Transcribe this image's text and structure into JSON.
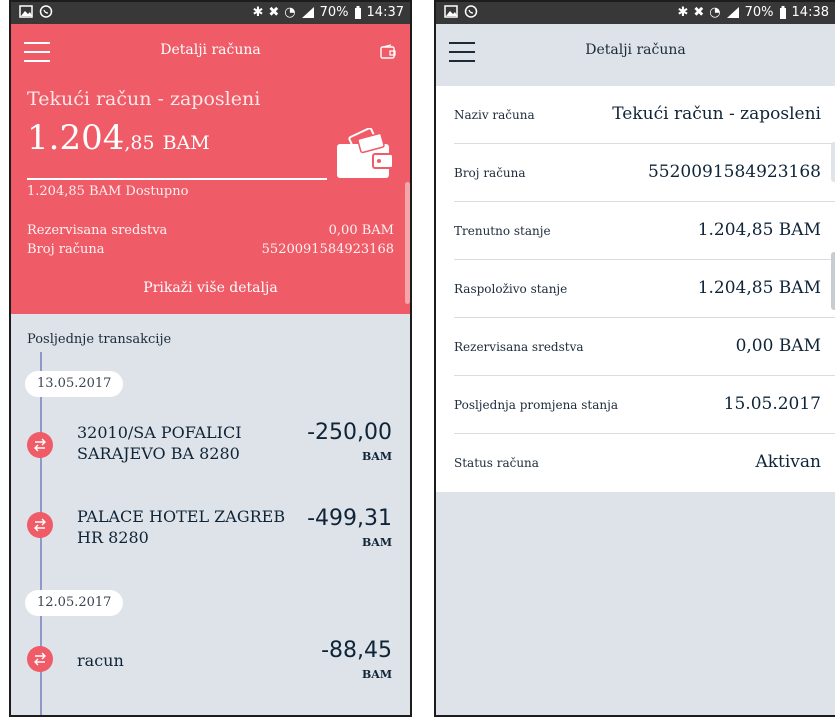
{
  "colors": {
    "accent": "#ef5b66",
    "background": "#dde3e8",
    "text": "#0f2438",
    "timeline": "#8f98c8"
  },
  "left": {
    "status": {
      "battery": "70%",
      "time": "14:37",
      "icons": [
        "image-icon",
        "whatsapp-icon",
        "bluetooth-icon",
        "mute-icon",
        "wifi-icon",
        "signal-icon",
        "battery-icon"
      ]
    },
    "appbar": {
      "title": "Detalji računa",
      "menu_icon": "hamburger-icon",
      "action_icon": "wallet-icon"
    },
    "account": {
      "name": "Tekući račun - zaposleni",
      "balance_int": "1.204",
      "balance_dec": ",85",
      "currency": "BAM",
      "available": "1.204,85 BAM Dostupno",
      "reserved_label": "Rezervisana sredstva",
      "reserved_value": "0,00 BAM",
      "number_label": "Broj računa",
      "number_value": "5520091584923168",
      "more_link": "Prikaži više detalja"
    },
    "transactions_header": "Posljednje transakcije",
    "dates": [
      "13.05.2017",
      "12.05.2017"
    ],
    "transactions": [
      {
        "description": "32010/SA POFALICI SARAJEVO BA 8280",
        "amount": "-250,00",
        "currency": "BAM"
      },
      {
        "description": "PALACE HOTEL ZAGREB HR 8280",
        "amount": "-499,31",
        "currency": "BAM"
      },
      {
        "description": "racun",
        "amount": "-88,45",
        "currency": "BAM"
      }
    ]
  },
  "right": {
    "status": {
      "battery": "70%",
      "time": "14:38",
      "icons": [
        "image-icon",
        "whatsapp-icon",
        "bluetooth-icon",
        "mute-icon",
        "wifi-icon",
        "signal-icon",
        "battery-icon"
      ]
    },
    "appbar": {
      "title": "Detalji računa",
      "menu_icon": "hamburger-icon"
    },
    "details": [
      {
        "label": "Naziv računa",
        "value": "Tekući račun - zaposleni"
      },
      {
        "label": "Broj računa",
        "value": "5520091584923168"
      },
      {
        "label": "Trenutno stanje",
        "value": "1.204,85 BAM"
      },
      {
        "label": "Raspoloživo stanje",
        "value": "1.204,85 BAM"
      },
      {
        "label": "Rezervisana sredstva",
        "value": "0,00 BAM"
      },
      {
        "label": "Posljednja promjena stanja",
        "value": "15.05.2017"
      },
      {
        "label": "Status računa",
        "value": "Aktivan"
      }
    ]
  }
}
